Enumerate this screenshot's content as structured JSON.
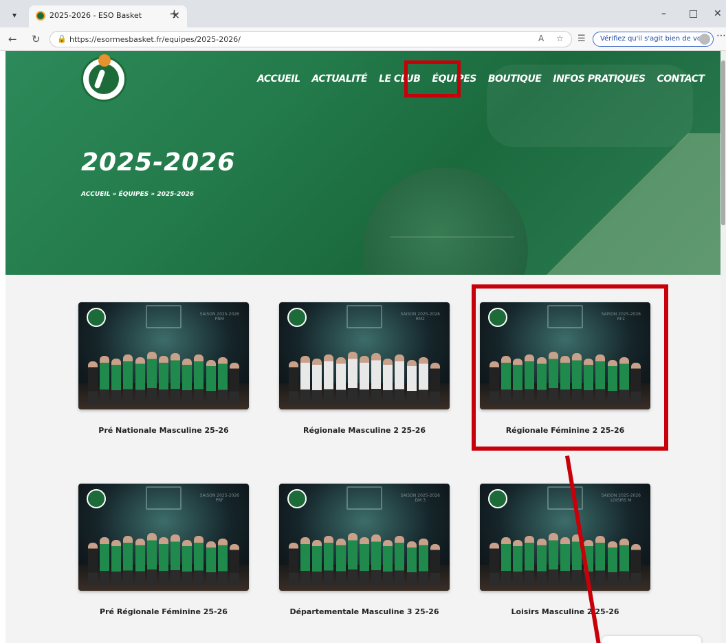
{
  "browser": {
    "tab_title": "2025-2026 - ESO Basket",
    "url": "https://esormesbasket.fr/equipes/2025-2026/",
    "verify_text": "Vérifiez qu'il s'agit bien de vous",
    "icons": [
      "tab-list-icon",
      "new-tab-icon",
      "minimize-icon",
      "maximize-icon",
      "close-icon",
      "back-icon",
      "refresh-icon",
      "lock-icon",
      "read-aloud-icon",
      "favorite-icon",
      "collections-icon",
      "more-icon"
    ]
  },
  "site": {
    "nav": [
      "ACCUEIL",
      "ACTUALITÉ",
      "LE CLUB",
      "ÉQUIPES",
      "BOUTIQUE",
      "INFOS PRATIQUES",
      "CONTACT"
    ],
    "page_title": "2025-2026",
    "breadcrumb": "ACCUEIL » ÉQUIPES » 2025-2026"
  },
  "teams": [
    {
      "name": "Pré Nationale Masculine 25-26",
      "season": "SAISON 2025-2026",
      "code": "PNM",
      "jersey": "#1f8a4c"
    },
    {
      "name": "Régionale Masculine 2 25-26",
      "season": "SAISON 2025-2026",
      "code": "RM2",
      "jersey": "#e8e8e8"
    },
    {
      "name": "Régionale Féminine 2 25-26",
      "season": "SAISON 2025-2026",
      "code": "RF2",
      "jersey": "#1f8a4c"
    },
    {
      "name": "Pré Régionale Féminine 25-26",
      "season": "SAISON 2025-2026",
      "code": "PRF",
      "jersey": "#1f8a4c"
    },
    {
      "name": "Départementale Masculine 3 25-26",
      "season": "SAISON 2025-2026",
      "code": "DM 3",
      "jersey": "#1f8a4c"
    },
    {
      "name": "Loisirs Masculine 2 25-26",
      "season": "SAISON 2025-2026",
      "code": "LOISIRS M",
      "jersey": "#1f8a4c"
    }
  ]
}
